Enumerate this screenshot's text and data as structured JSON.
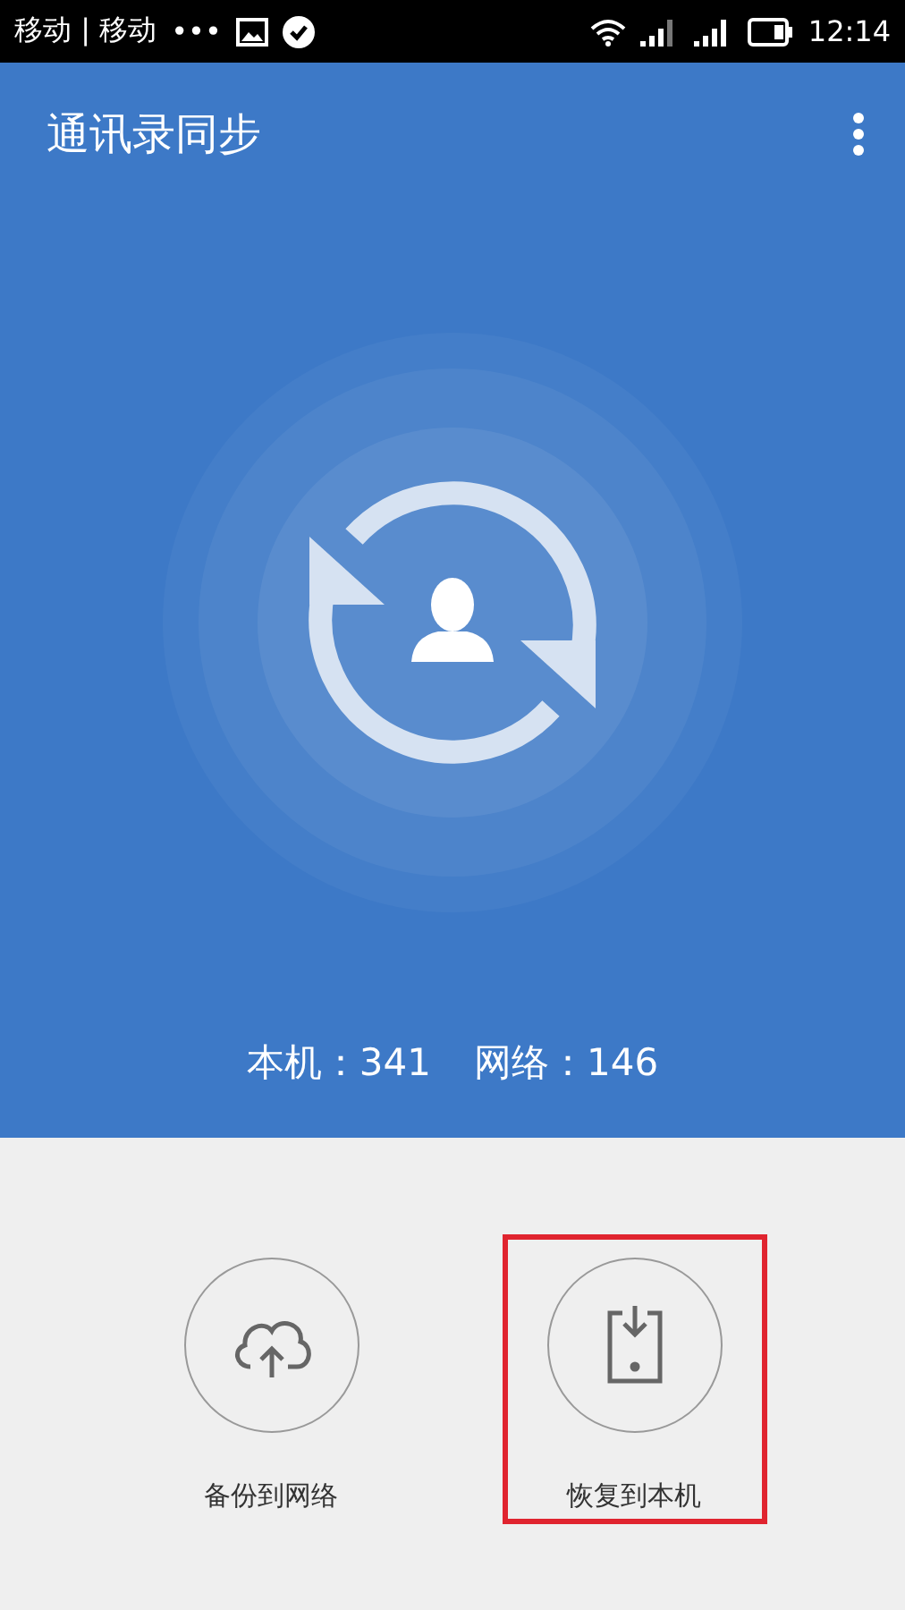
{
  "status_bar": {
    "carriers": "移动 | 移动",
    "more": "•••",
    "time": "12:14"
  },
  "app_bar": {
    "title": "通讯录同步"
  },
  "counts": [
    {
      "label": "本机：341"
    },
    {
      "label": "网络：146"
    }
  ],
  "actions": [
    {
      "kind": "backup",
      "label": "备份到网络",
      "highlighted": false
    },
    {
      "kind": "restore",
      "label": "恢复到本机",
      "highlighted": true
    }
  ]
}
